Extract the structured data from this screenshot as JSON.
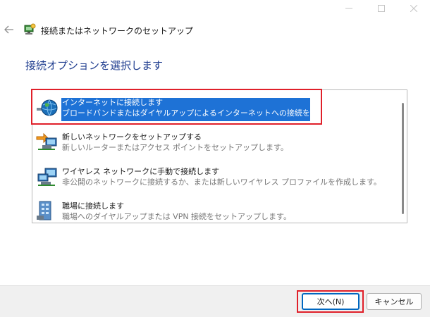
{
  "window": {
    "title": "接続またはネットワークのセットアップ",
    "heading": "接続オプションを選択します"
  },
  "options": [
    {
      "title": "インターネットに接続します",
      "desc": "ブロードバンドまたはダイヤルアップによるインターネットへの接続を設定します。",
      "icon": "globe-network-icon",
      "selected": true
    },
    {
      "title": "新しいネットワークをセットアップする",
      "desc": "新しいルーターまたはアクセス ポイントをセットアップします。",
      "icon": "new-network-icon",
      "selected": false
    },
    {
      "title": "ワイヤレス ネットワークに手動で接続します",
      "desc": "非公開のネットワークに接続するか、または新しいワイヤレス プロファイルを作成します。",
      "icon": "wireless-network-icon",
      "selected": false
    },
    {
      "title": "職場に接続します",
      "desc": "職場へのダイヤルアップまたは VPN 接続をセットアップします。",
      "icon": "workplace-connection-icon",
      "selected": false
    }
  ],
  "buttons": {
    "next": "次へ(N)",
    "cancel": "キャンセル"
  },
  "colors": {
    "selection": "#1e72d6",
    "heading": "#1f3d8f",
    "highlight": "#e0202a"
  }
}
